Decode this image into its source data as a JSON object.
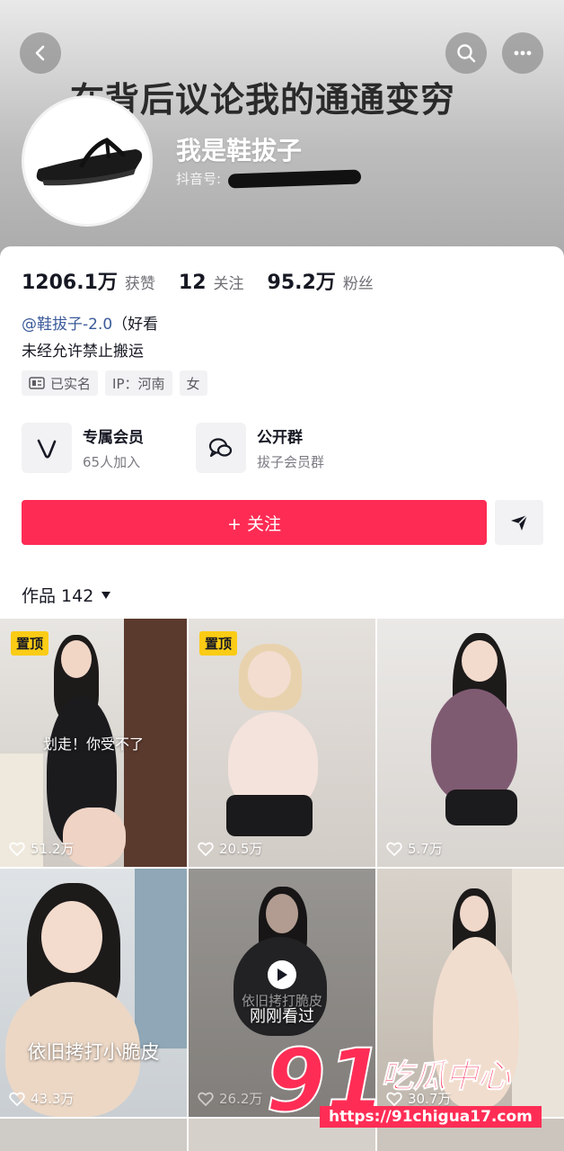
{
  "header": {
    "bg_title": "在背后议论我的通通变穷",
    "nickname": "我是鞋拔子",
    "douyin_id_label": "抖音号:"
  },
  "stats": [
    {
      "num": "1206.1万",
      "label": "获赞"
    },
    {
      "num": "12",
      "label": "关注"
    },
    {
      "num": "95.2万",
      "label": "粉丝"
    }
  ],
  "bio": {
    "mention": "@鞋拔子-2.0",
    "mention_suffix": "（好看",
    "line2": "未经允许禁止搬运"
  },
  "tags": {
    "verified": "已实名",
    "ip": "IP：河南",
    "gender": "女"
  },
  "features": [
    {
      "title": "专属会员",
      "sub": "65人加入",
      "icon": "v-member-icon"
    },
    {
      "title": "公开群",
      "sub": "拔子会员群",
      "icon": "chat-group-icon"
    }
  ],
  "actions": {
    "follow": "+ 关注"
  },
  "works": {
    "label": "作品 142"
  },
  "videos": [
    {
      "pinned": "置顶",
      "caption": "划走！你受不了",
      "likes": "51.2万"
    },
    {
      "pinned": "置顶",
      "caption": "",
      "likes": "20.5万"
    },
    {
      "pinned": "",
      "caption": "",
      "likes": "5.7万"
    },
    {
      "pinned": "",
      "caption": "依旧拷打小脆皮",
      "likes": "43.3万"
    },
    {
      "pinned": "",
      "caption": "刚刚看过",
      "sub_caption": "依旧拷打脆皮",
      "likes": "26.2万"
    },
    {
      "pinned": "",
      "caption": "",
      "likes": "30.7万"
    }
  ],
  "watermark": {
    "num": "91",
    "cn": "吃瓜中心",
    "url": "https://91chigua17.com"
  },
  "colors": {
    "accent": "#fe2c55",
    "pin": "#facc15",
    "mention": "#3b5a9a"
  }
}
